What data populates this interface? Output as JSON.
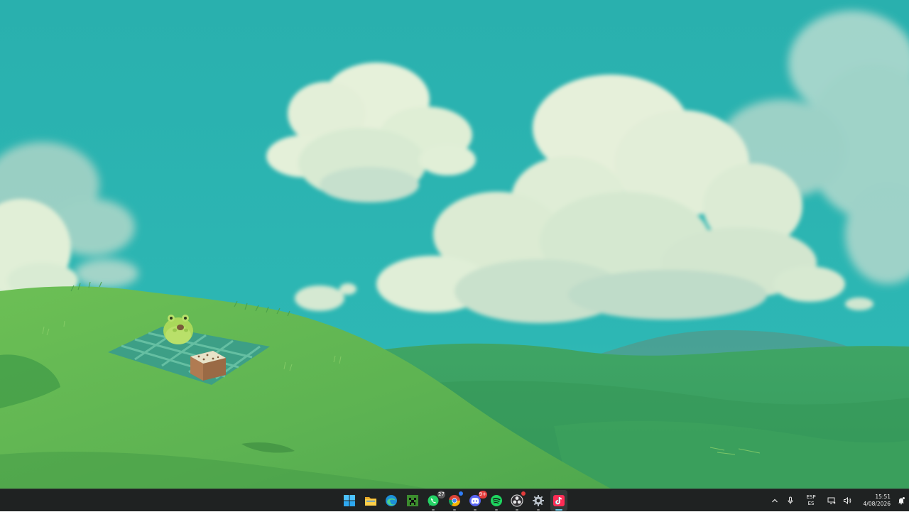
{
  "wallpaper": {
    "description_colors": {
      "sky": "#2bb2b0",
      "cloud": "#e4f1d6",
      "grass_front": "#59b34f",
      "grass_back": "#3fa36b"
    }
  },
  "taskbar": {
    "background": "#1f2222",
    "apps": [
      {
        "name": "start-button",
        "icon": "windows-logo-icon",
        "pinned": true
      },
      {
        "name": "file-explorer-button",
        "icon": "folder-icon",
        "pinned": true
      },
      {
        "name": "edge-button",
        "icon": "edge-icon",
        "pinned": true
      },
      {
        "name": "minecraft-button",
        "icon": "minecraft-icon",
        "pinned": true
      },
      {
        "name": "whatsapp-button",
        "icon": "whatsapp-icon",
        "badge": "27",
        "open": true
      },
      {
        "name": "chrome-button",
        "icon": "chrome-icon",
        "badge_dot": true,
        "open": true
      },
      {
        "name": "discord-button",
        "icon": "discord-icon",
        "badge": "9+",
        "open": true
      },
      {
        "name": "spotify-button",
        "icon": "spotify-icon",
        "open": true
      },
      {
        "name": "obs-button",
        "icon": "obs-icon",
        "badge_dot": true,
        "open": true
      },
      {
        "name": "settings-button",
        "icon": "gear-icon",
        "open": true
      },
      {
        "name": "tiktok-button",
        "icon": "tiktok-icon",
        "active": true
      }
    ],
    "whatsapp_badge": "27",
    "discord_badge": "9+"
  },
  "tray": {
    "language_top": "ESP",
    "language_bottom": "ES",
    "time": "15:51",
    "date": "4/08/2026"
  }
}
